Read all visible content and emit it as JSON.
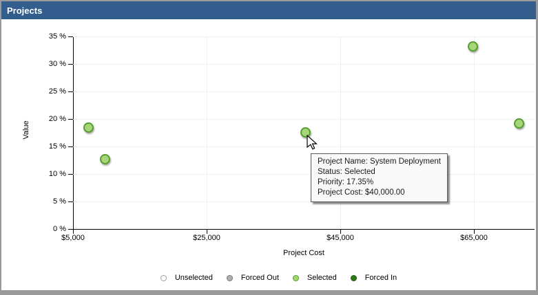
{
  "window": {
    "title": "Projects"
  },
  "colors": {
    "titlebar_bg": "#325D8C",
    "titlebar_text": "#FFFFFF",
    "panel_border": "#9A9A9A",
    "gridline": "#EFEFF6",
    "axis": "#000000",
    "point_fill": "#A7D57A",
    "point_border": "#55A02C"
  },
  "chart_data": {
    "type": "scatter",
    "title": "",
    "xlabel": "Project Cost",
    "ylabel": "Value",
    "xlim": [
      5000,
      74000
    ],
    "ylim": [
      0,
      35
    ],
    "grid": true,
    "legend_position": "bottom",
    "x_ticks": [
      {
        "value": 5000,
        "label": "$5,000"
      },
      {
        "value": 25000,
        "label": "$25,000"
      },
      {
        "value": 45000,
        "label": "$45,000"
      },
      {
        "value": 65000,
        "label": "$65,000"
      }
    ],
    "y_ticks": [
      {
        "value": 0,
        "label": "0 %"
      },
      {
        "value": 5,
        "label": "5 %"
      },
      {
        "value": 10,
        "label": "10 %"
      },
      {
        "value": 15,
        "label": "15 %"
      },
      {
        "value": 20,
        "label": "20 %"
      },
      {
        "value": 25,
        "label": "25 %"
      },
      {
        "value": 30,
        "label": "30 %"
      },
      {
        "value": 35,
        "label": "35 %"
      }
    ],
    "series": [
      {
        "name": "Selected",
        "fill": "#A7D57A",
        "border": "#55A02C",
        "points": [
          {
            "x": 7500,
            "y": 18.2
          },
          {
            "x": 10000,
            "y": 12.4
          },
          {
            "x": 40000,
            "y": 17.35,
            "hovered": true
          },
          {
            "x": 65000,
            "y": 33
          },
          {
            "x": 72000,
            "y": 19
          }
        ]
      }
    ],
    "legend": [
      {
        "label": "Unselected",
        "fill": "#FCFCFC",
        "border": "#9E9E9E"
      },
      {
        "label": "Forced Out",
        "fill": "#B0B0B0",
        "border": "#757575"
      },
      {
        "label": "Selected",
        "fill": "#9ED96B",
        "border": "#4E9A2E"
      },
      {
        "label": "Forced In",
        "fill": "#2B7A15",
        "border": "#1E5A0F"
      }
    ]
  },
  "tooltip": {
    "lines": [
      "Project Name: System Deployment",
      "Status: Selected",
      "Priority: 17.35%",
      "Project Cost: $40,000.00"
    ]
  }
}
